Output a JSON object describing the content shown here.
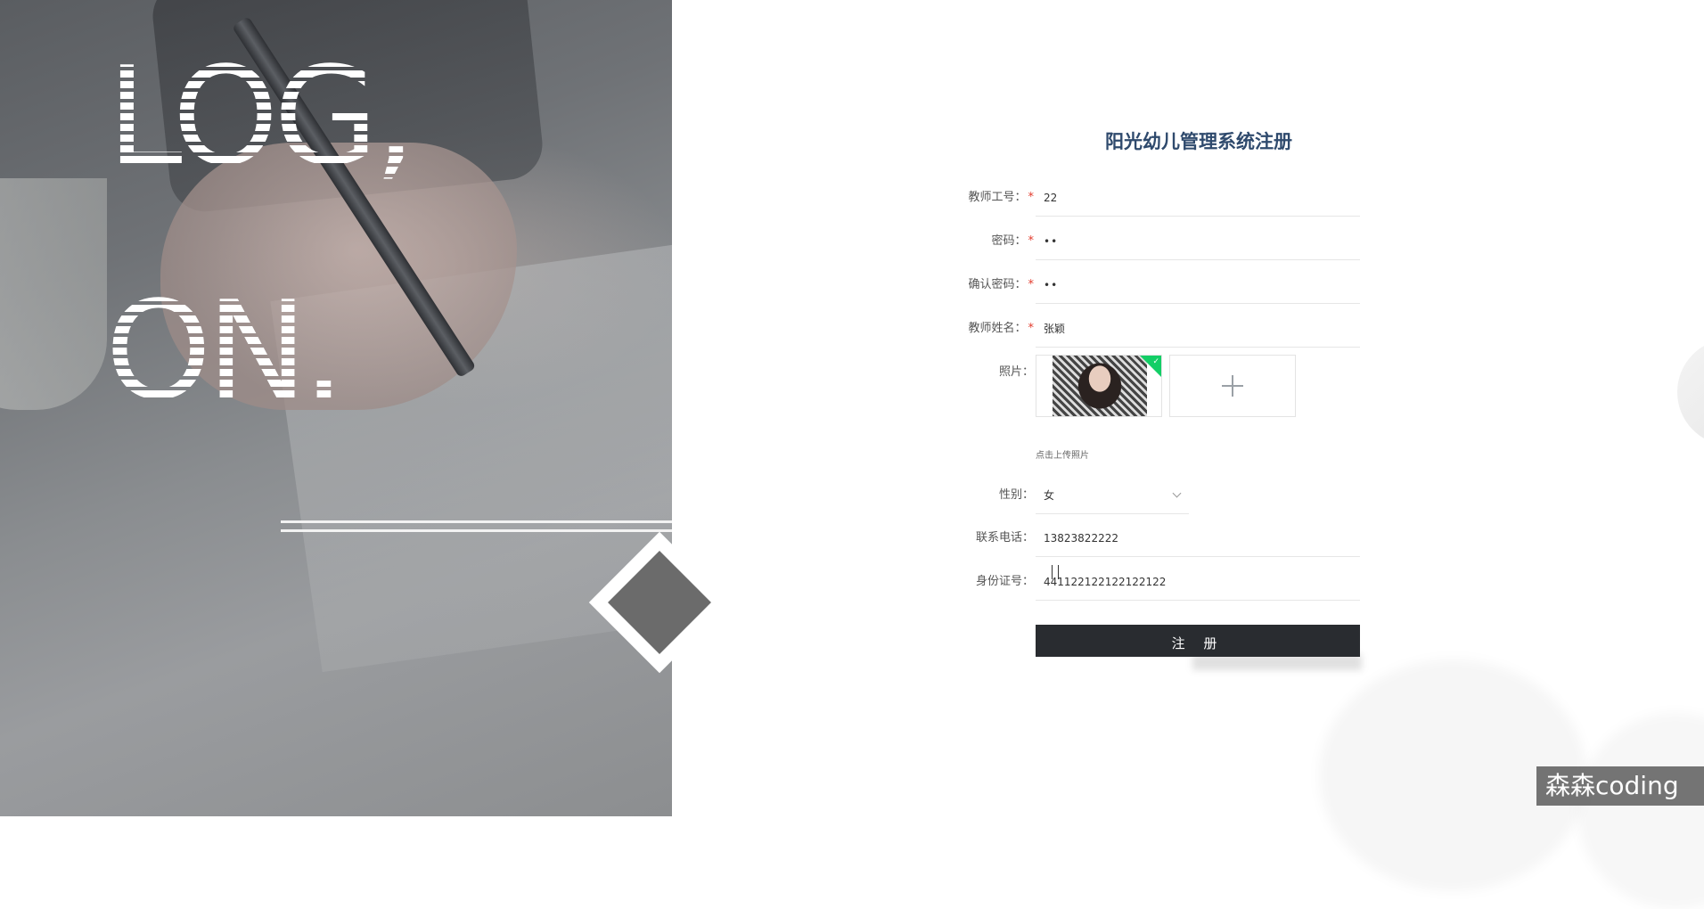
{
  "hero": {
    "line1": "LOG,",
    "line2": "ON."
  },
  "form": {
    "title": "阳光幼儿管理系统注册",
    "fields": {
      "teacher_id": {
        "label": "教师工号：",
        "required": true,
        "value": "22"
      },
      "password": {
        "label": "密码：",
        "required": true,
        "value": "••"
      },
      "confirm_password": {
        "label": "确认密码：",
        "required": true,
        "value": "••"
      },
      "teacher_name": {
        "label": "教师姓名：",
        "required": true,
        "value": "张颖"
      },
      "photo": {
        "label": "照片：",
        "hint": "点击上传照片"
      },
      "gender": {
        "label": "性别：",
        "value": "女"
      },
      "phone": {
        "label": "联系电话：",
        "value": "13823822222"
      },
      "id_card": {
        "label": "身份证号：",
        "value": "441122122122122122"
      }
    },
    "required_mark": "*",
    "submit_label": "注 册"
  },
  "watermark": "森森coding",
  "colors": {
    "title": "#2f4a6d",
    "required": "#e23b2c",
    "submit_bg": "#292c30",
    "upload_success": "#13ce66"
  }
}
